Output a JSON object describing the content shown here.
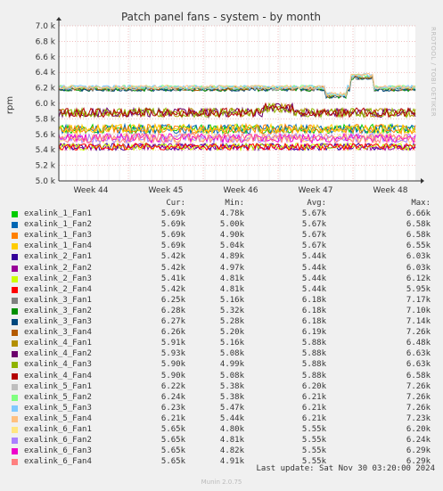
{
  "chart_data": {
    "type": "line",
    "title": "Patch panel fans - system - by month",
    "ylabel": "rpm",
    "xlabel": "",
    "ylim": [
      5000,
      7000
    ],
    "y_ticks": [
      "5.0 k",
      "5.2 k",
      "5.4 k",
      "5.6 k",
      "5.8 k",
      "6.0 k",
      "6.2 k",
      "6.4 k",
      "6.6 k",
      "6.8 k",
      "7.0 k"
    ],
    "x_ticks": [
      "Week 44",
      "Week 45",
      "Week 46",
      "Week 47",
      "Week 48"
    ],
    "grid": true,
    "legend_columns": [
      "Cur:",
      "Min:",
      "Avg:",
      "Max:"
    ],
    "series": [
      {
        "name": "exalink_1_Fan1",
        "color": "#00cc00",
        "cur": "5.69k",
        "min": "4.78k",
        "avg": "5.67k",
        "max": "6.66k",
        "base": 5670
      },
      {
        "name": "exalink_1_Fan2",
        "color": "#0066b3",
        "cur": "5.69k",
        "min": "5.00k",
        "avg": "5.67k",
        "max": "6.58k",
        "base": 5670
      },
      {
        "name": "exalink_1_Fan3",
        "color": "#ff8000",
        "cur": "5.69k",
        "min": "4.90k",
        "avg": "5.67k",
        "max": "6.58k",
        "base": 5670
      },
      {
        "name": "exalink_1_Fan4",
        "color": "#ffcc00",
        "cur": "5.69k",
        "min": "5.04k",
        "avg": "5.67k",
        "max": "6.55k",
        "base": 5670
      },
      {
        "name": "exalink_2_Fan1",
        "color": "#330099",
        "cur": "5.42k",
        "min": "4.89k",
        "avg": "5.44k",
        "max": "6.03k",
        "base": 5440
      },
      {
        "name": "exalink_2_Fan2",
        "color": "#990099",
        "cur": "5.42k",
        "min": "4.97k",
        "avg": "5.44k",
        "max": "6.03k",
        "base": 5440
      },
      {
        "name": "exalink_2_Fan3",
        "color": "#ccff00",
        "cur": "5.41k",
        "min": "4.81k",
        "avg": "5.44k",
        "max": "6.12k",
        "base": 5440
      },
      {
        "name": "exalink_2_Fan4",
        "color": "#ff0000",
        "cur": "5.42k",
        "min": "4.81k",
        "avg": "5.44k",
        "max": "5.95k",
        "base": 5440
      },
      {
        "name": "exalink_3_Fan1",
        "color": "#808080",
        "cur": "6.25k",
        "min": "5.16k",
        "avg": "6.18k",
        "max": "7.17k",
        "base": 6180
      },
      {
        "name": "exalink_3_Fan2",
        "color": "#008f00",
        "cur": "6.28k",
        "min": "5.32k",
        "avg": "6.18k",
        "max": "7.10k",
        "base": 6180
      },
      {
        "name": "exalink_3_Fan3",
        "color": "#00487d",
        "cur": "6.27k",
        "min": "5.28k",
        "avg": "6.18k",
        "max": "7.14k",
        "base": 6180
      },
      {
        "name": "exalink_3_Fan4",
        "color": "#b35a00",
        "cur": "6.26k",
        "min": "5.20k",
        "avg": "6.19k",
        "max": "7.26k",
        "base": 6190
      },
      {
        "name": "exalink_4_Fan1",
        "color": "#b38f00",
        "cur": "5.91k",
        "min": "5.16k",
        "avg": "5.88k",
        "max": "6.48k",
        "base": 5880
      },
      {
        "name": "exalink_4_Fan2",
        "color": "#6b006b",
        "cur": "5.93k",
        "min": "5.08k",
        "avg": "5.88k",
        "max": "6.63k",
        "base": 5880
      },
      {
        "name": "exalink_4_Fan3",
        "color": "#8fb300",
        "cur": "5.90k",
        "min": "4.99k",
        "avg": "5.88k",
        "max": "6.63k",
        "base": 5880
      },
      {
        "name": "exalink_4_Fan4",
        "color": "#b30000",
        "cur": "5.90k",
        "min": "5.08k",
        "avg": "5.88k",
        "max": "6.58k",
        "base": 5880
      },
      {
        "name": "exalink_5_Fan1",
        "color": "#bebebe",
        "cur": "6.22k",
        "min": "5.38k",
        "avg": "6.20k",
        "max": "7.26k",
        "base": 6200
      },
      {
        "name": "exalink_5_Fan2",
        "color": "#80ff80",
        "cur": "6.24k",
        "min": "5.38k",
        "avg": "6.21k",
        "max": "7.26k",
        "base": 6210
      },
      {
        "name": "exalink_5_Fan3",
        "color": "#80c9ff",
        "cur": "6.23k",
        "min": "5.47k",
        "avg": "6.21k",
        "max": "7.26k",
        "base": 6210
      },
      {
        "name": "exalink_5_Fan4",
        "color": "#ffc080",
        "cur": "6.21k",
        "min": "5.44k",
        "avg": "6.21k",
        "max": "7.23k",
        "base": 6210
      },
      {
        "name": "exalink_6_Fan1",
        "color": "#ffe680",
        "cur": "5.65k",
        "min": "4.80k",
        "avg": "5.55k",
        "max": "6.20k",
        "base": 5550
      },
      {
        "name": "exalink_6_Fan2",
        "color": "#aa80ff",
        "cur": "5.65k",
        "min": "4.81k",
        "avg": "5.55k",
        "max": "6.24k",
        "base": 5550
      },
      {
        "name": "exalink_6_Fan3",
        "color": "#ee00cc",
        "cur": "5.65k",
        "min": "4.82k",
        "avg": "5.55k",
        "max": "6.29k",
        "base": 5550
      },
      {
        "name": "exalink_6_Fan4",
        "color": "#ff8080",
        "cur": "5.65k",
        "min": "4.91k",
        "avg": "5.55k",
        "max": "6.29k",
        "base": 5550
      }
    ]
  },
  "last_update": "Last update: Sat Nov 30 03:20:00 2024",
  "footer": "Munin 2.0.75",
  "vendor": "RRDTOOL / TOBI OETIKER"
}
